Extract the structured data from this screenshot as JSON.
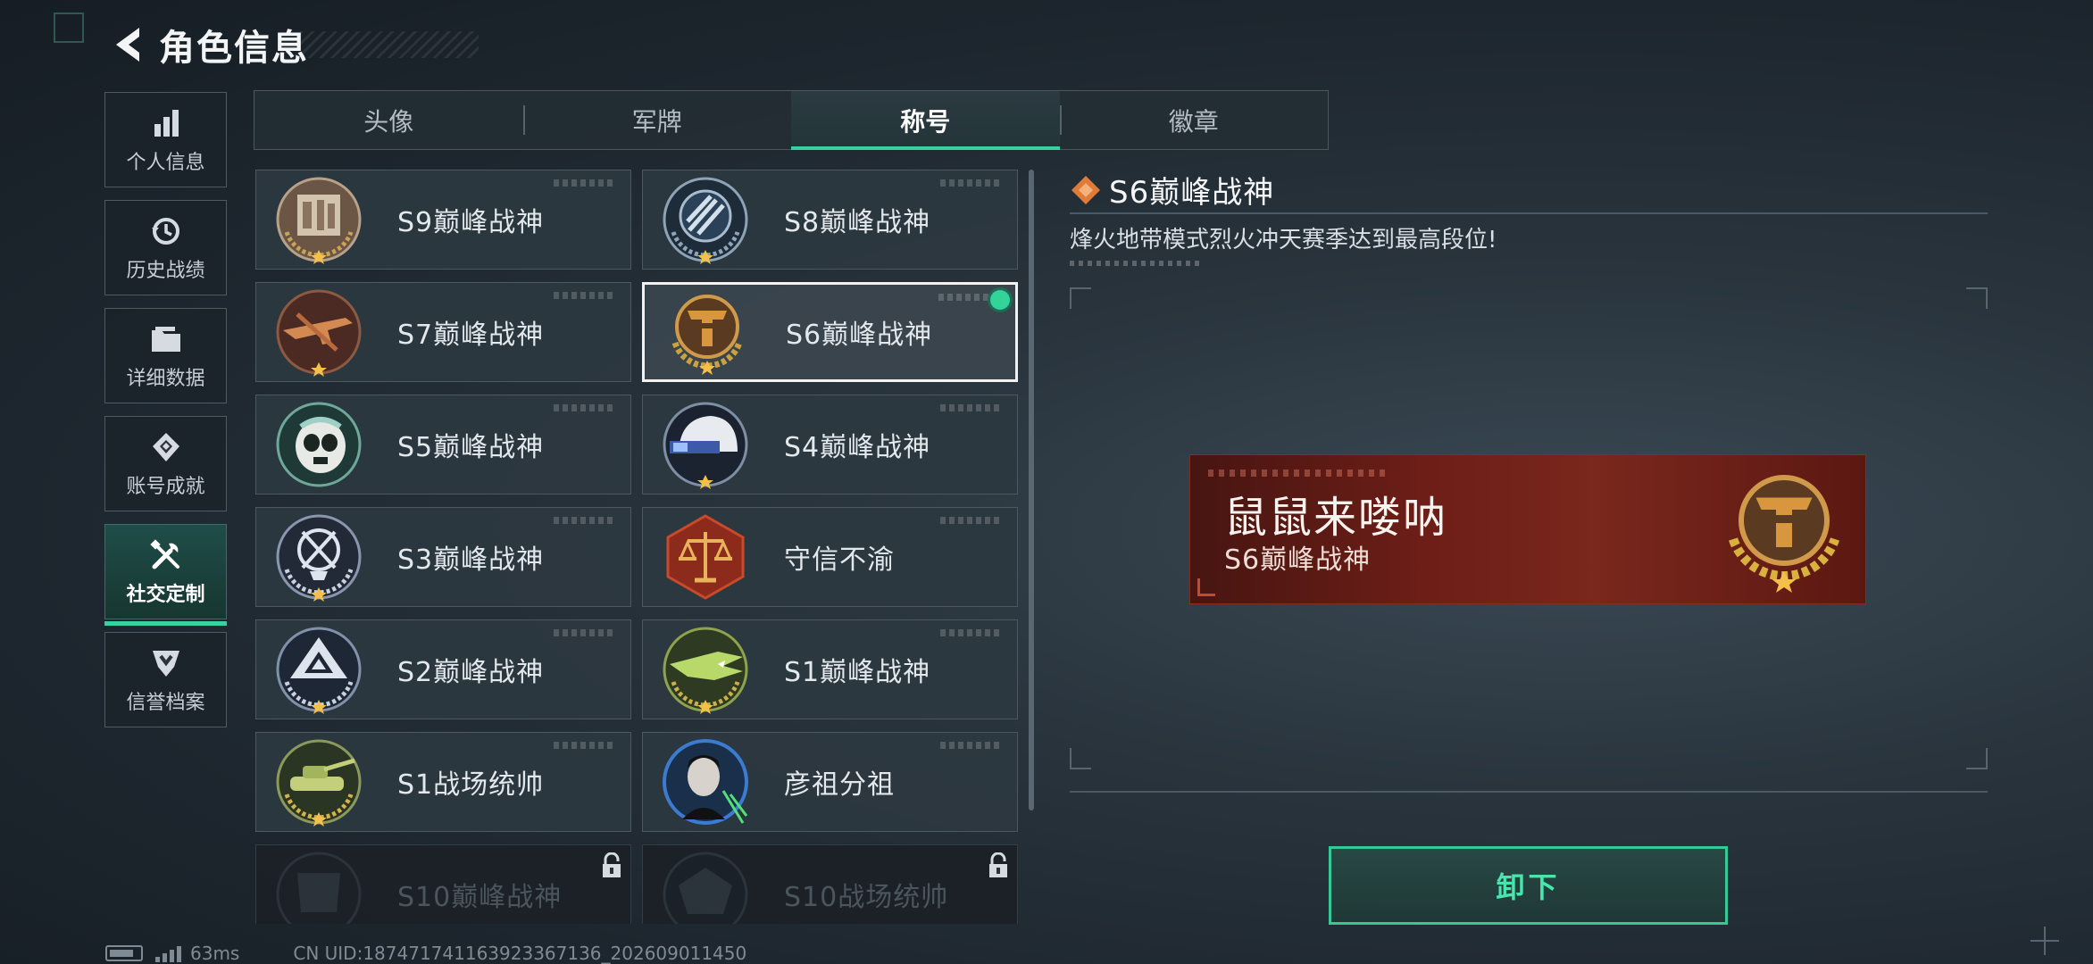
{
  "header": {
    "title": "角色信息",
    "back_icon": "back-arrow-icon"
  },
  "sidebar": {
    "items": [
      {
        "label": "个人信息",
        "icon": "bar-chart-icon",
        "active": false
      },
      {
        "label": "历史战绩",
        "icon": "history-clock-icon",
        "active": false
      },
      {
        "label": "详细数据",
        "icon": "folder-icon",
        "active": false
      },
      {
        "label": "账号成就",
        "icon": "achievement-medal-icon",
        "active": false
      },
      {
        "label": "社交定制",
        "icon": "tools-icon",
        "active": true
      },
      {
        "label": "信誉档案",
        "icon": "shield-chevron-icon",
        "active": false
      }
    ]
  },
  "tabs": [
    {
      "label": "头像",
      "active": false
    },
    {
      "label": "军牌",
      "active": false
    },
    {
      "label": "称号",
      "active": true
    },
    {
      "label": "徽章",
      "active": false
    }
  ],
  "titles": [
    {
      "name": "S9巅峰战神",
      "emblem": "s9-emblem",
      "state": "normal"
    },
    {
      "name": "S8巅峰战神",
      "emblem": "s8-emblem",
      "state": "normal"
    },
    {
      "name": "S7巅峰战神",
      "emblem": "s7-rifle-emblem",
      "state": "normal"
    },
    {
      "name": "S6巅峰战神",
      "emblem": "s6-t-emblem",
      "state": "selected"
    },
    {
      "name": "S5巅峰战神",
      "emblem": "s5-skull-emblem",
      "state": "normal"
    },
    {
      "name": "S4巅峰战神",
      "emblem": "s4-helmet-emblem",
      "state": "normal"
    },
    {
      "name": "S3巅峰战神",
      "emblem": "s3-globe-emblem",
      "state": "normal"
    },
    {
      "name": "守信不渝",
      "emblem": "scales-emblem",
      "state": "normal"
    },
    {
      "name": "S2巅峰战神",
      "emblem": "s2-triangle-emblem",
      "state": "normal"
    },
    {
      "name": "S1巅峰战神",
      "emblem": "s1-crocodile-emblem",
      "state": "normal"
    },
    {
      "name": "S1战场统帅",
      "emblem": "tank-emblem",
      "state": "normal"
    },
    {
      "name": "彦祖分祖",
      "emblem": "portrait-emblem",
      "state": "normal"
    },
    {
      "name": "S10巅峰战神",
      "emblem": "s10-emblem",
      "state": "locked"
    },
    {
      "name": "S10战场统帅",
      "emblem": "s10-commander-emblem",
      "state": "locked"
    }
  ],
  "detail": {
    "title": "S6巅峰战神",
    "description": "烽火地带模式烈火冲天赛季达到最高段位!",
    "preview": {
      "player_name": "鼠鼠来喽呐",
      "title": "S6巅峰战神"
    },
    "unequip_label": "卸下"
  },
  "status": {
    "ping": "63ms",
    "uid": "CN UID:187471741163923367136_202609011450"
  },
  "colors": {
    "accent": "#35d3a0",
    "banner": "#6d1e17",
    "gold": "#c9913a"
  }
}
